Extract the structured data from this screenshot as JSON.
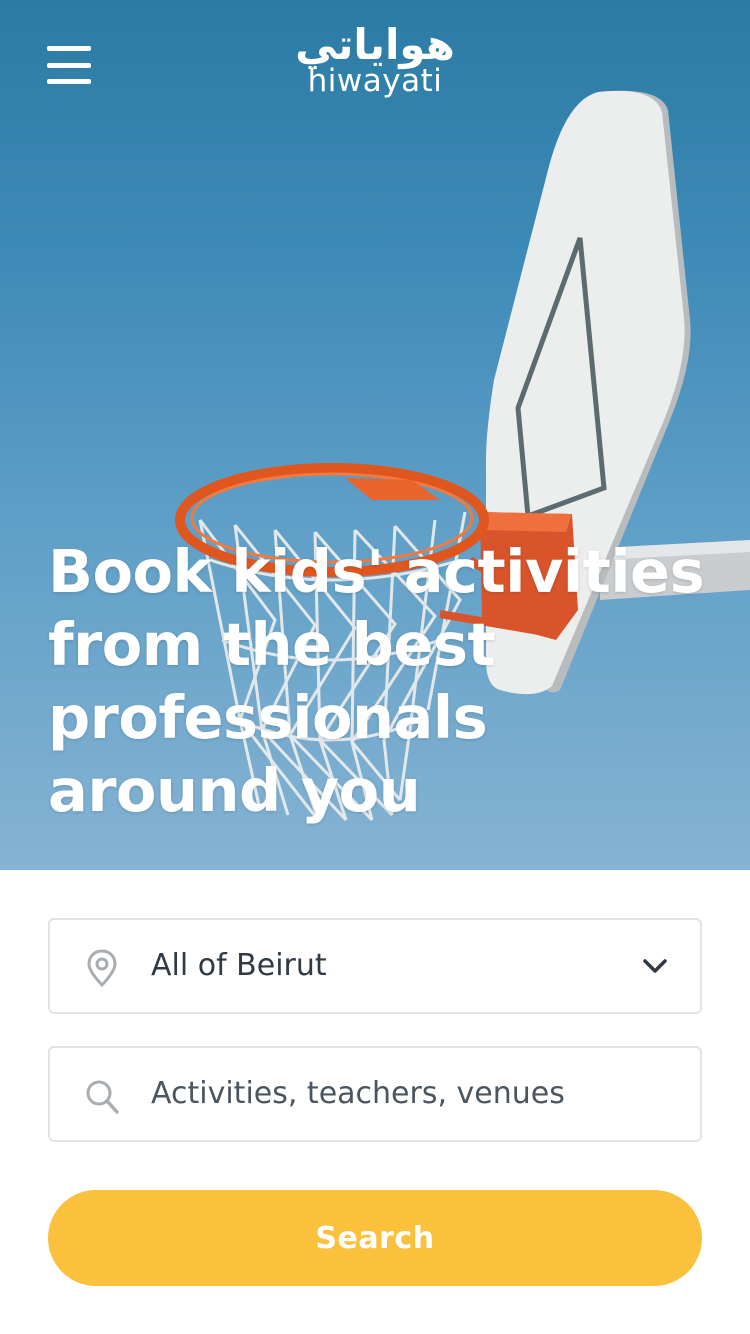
{
  "header": {
    "menu_icon": "hamburger-menu-icon",
    "logo_arabic": "هواياتي",
    "logo_latin": "hiwayati"
  },
  "hero": {
    "image": "basketball-hoop-sky",
    "heading_lines": [
      "Book kids' activities",
      "from the best",
      "professionals",
      "around you"
    ]
  },
  "search_form": {
    "location": {
      "icon": "map-pin-icon",
      "value": "All of Beirut",
      "dropdown_icon": "chevron-down-icon"
    },
    "query": {
      "icon": "search-icon",
      "placeholder": "Activities, teachers, venues"
    },
    "submit_label": "Search"
  },
  "colors": {
    "accent": "#fbc03c",
    "text": "#2f3a45",
    "border": "#e1e3e5",
    "icon_gray": "#a8adb2"
  }
}
